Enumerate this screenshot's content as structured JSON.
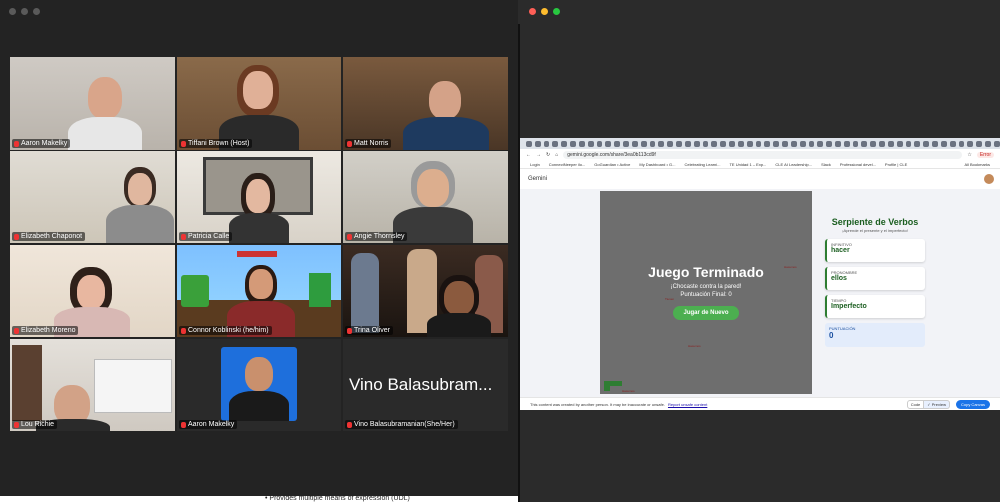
{
  "zoom": {
    "participants": [
      {
        "name": "Aaron Makelky"
      },
      {
        "name": "Tiffani Brown (Host)"
      },
      {
        "name": "Matt Norris"
      },
      {
        "name": "Elizabeth Chaponot"
      },
      {
        "name": "Patricia Calle"
      },
      {
        "name": "Angie Thornsley"
      },
      {
        "name": "Elizabeth Moreno"
      },
      {
        "name": "Connor Koblinski (he/him)"
      },
      {
        "name": "Trina Oliver"
      },
      {
        "name": "Lou Richie"
      },
      {
        "name": "Aaron Makelky"
      },
      {
        "name": "Vino Balasubramanian(She/Her)",
        "display_text": "Vino Balasubram..."
      }
    ],
    "doc_text": "Provides multiple means of expression (UDL)"
  },
  "browser": {
    "url": "gemini.google.com/share/3ea0b113cd9f",
    "bookmarks": [
      "Login",
      "ConnectNeeper ilo...",
      "GoGuardian • Active",
      "My Dashboard • G...",
      "Celebrating Learni...",
      "TE Unidad 1 – Exp...",
      "CLE AI Leadership...",
      "Slack",
      "Professional devel...",
      "Profile | CLE"
    ],
    "bookmarks_right": "All Bookmarks",
    "profile_button": "Error",
    "app_name": "Gemini"
  },
  "game": {
    "title": "Juego Terminado",
    "message": "¡Chocaste contra la pared!",
    "score_text": "Puntuación Final: 0",
    "play_again": "Jugar de Nuevo",
    "labels": {
      "top_right": "Hacemos",
      "left": "Tienen",
      "bottom": "Hacemos",
      "corner": "Hacemos"
    }
  },
  "panel": {
    "title": "Serpiente de Verbos",
    "subtitle": "¡Aprende el presente y el imperfecto!",
    "infinitivo_label": "INFINITIVO",
    "infinitivo_value": "hacer",
    "pronombre_label": "PRONOMBRE",
    "pronombre_value": "ellos",
    "tiempo_label": "TIEMPO",
    "tiempo_value": "Imperfecto",
    "puntuacion_label": "PUNTUACIÓN",
    "puntuacion_value": "0"
  },
  "footer": {
    "notice": "This content was created by another person. It may be inaccurate or unsafe.",
    "report": "Report unsafe content",
    "code_tab": "Code",
    "preview_tab": "Preview",
    "copy_button": "Copy Canvas"
  },
  "colors": {
    "accent_green": "#4caf50",
    "panel_green": "#1b5e20",
    "board_gray": "#6e6e6e",
    "copy_blue": "#1a73e8"
  }
}
